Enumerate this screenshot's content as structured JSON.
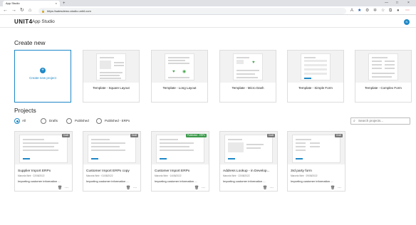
{
  "browser": {
    "tab_title": "App Studio",
    "tab_close": "×",
    "new_tab": "+",
    "url": "https://salesdemo-studio.unit4.com",
    "window_controls": [
      "—",
      "□",
      "×"
    ]
  },
  "app": {
    "logo": "UNIT4",
    "name": "App Studio",
    "avatar": "N"
  },
  "create_new": {
    "heading": "Create new",
    "create_label": "Create new project",
    "templates": [
      {
        "label": "Template - Square Layout"
      },
      {
        "label": "Template - Long Layout"
      },
      {
        "label": "Template - Micro Dash"
      },
      {
        "label": "Template - Simple Form"
      },
      {
        "label": "Template - Complex Form"
      }
    ]
  },
  "projects": {
    "heading": "Projects",
    "filters": [
      {
        "label": "All",
        "selected": true
      },
      {
        "label": "Drafts",
        "selected": false
      },
      {
        "label": "Published",
        "selected": false
      },
      {
        "label": "Published - ERPx",
        "selected": false
      }
    ],
    "search_placeholder": "Search projects...",
    "items": [
      {
        "name": "Supplier Import ERPx",
        "meta": "Marcela Weir · 22/08/2022",
        "desc": "Importing customer information ...",
        "badge": "Draft",
        "badge_color": "#777777"
      },
      {
        "name": "Customer Import ERPx copy",
        "meta": "Marcela Weir · 01/08/2022",
        "desc": "Importing customer information ...",
        "badge": "Draft",
        "badge_color": "#777777"
      },
      {
        "name": "Customer Import ERPx",
        "meta": "Marcela Weir · 14/08/2022",
        "desc": "Importing customer information ...",
        "badge": "Published - ERPx",
        "badge_color": "#3b9a4b"
      },
      {
        "name": "Address Lookup - in Develop...",
        "meta": "Marcela Weir · 22/08/2022",
        "desc": "Importing customer information ...",
        "badge": "Draft",
        "badge_color": "#777777"
      },
      {
        "name": "3rd party form",
        "meta": "Marcela Weir · 29/08/2022",
        "desc": "Importing customer information ...",
        "badge": "Draft",
        "badge_color": "#777777"
      }
    ]
  },
  "colors": {
    "accent": "#1e88c7",
    "published": "#3b9a4b"
  }
}
